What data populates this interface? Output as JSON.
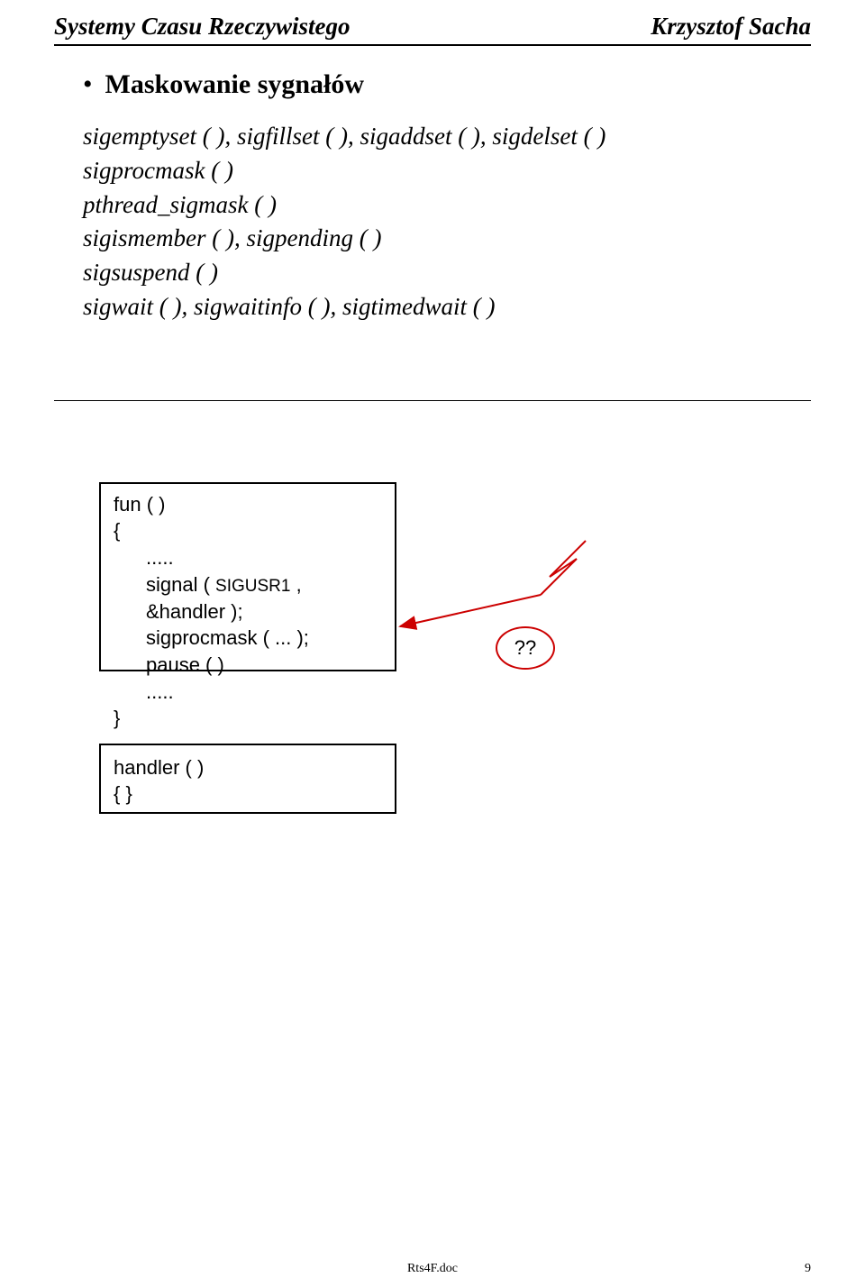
{
  "header": {
    "left": "Systemy Czasu Rzeczywistego",
    "right": "Krzysztof Sacha"
  },
  "section": {
    "title": "Maskowanie sygnałów",
    "lines": [
      "sigemptyset ( ), sigfillset ( ), sigaddset ( ), sigdelset ( )",
      "sigprocmask ( )",
      "pthread_sigmask ( )",
      "sigismember ( ), sigpending ( )",
      "sigsuspend ( )",
      "sigwait ( ), sigwaitinfo ( ), sigtimedwait ( )"
    ]
  },
  "box1": {
    "l1": "fun ( )",
    "l2": "{",
    "l3": ".....",
    "l4_pre": "signal ( ",
    "l4_sc": "SIGUSR1",
    "l4_post": " , &handler );",
    "l5": "sigprocmask ( ... );",
    "l6": "pause ( )",
    "l7": ".....",
    "l8": "}"
  },
  "box2": {
    "l1": "handler ( )",
    "l2": "{  }"
  },
  "qq": "??",
  "footer": {
    "center": "Rts4F.doc",
    "right": "9"
  }
}
